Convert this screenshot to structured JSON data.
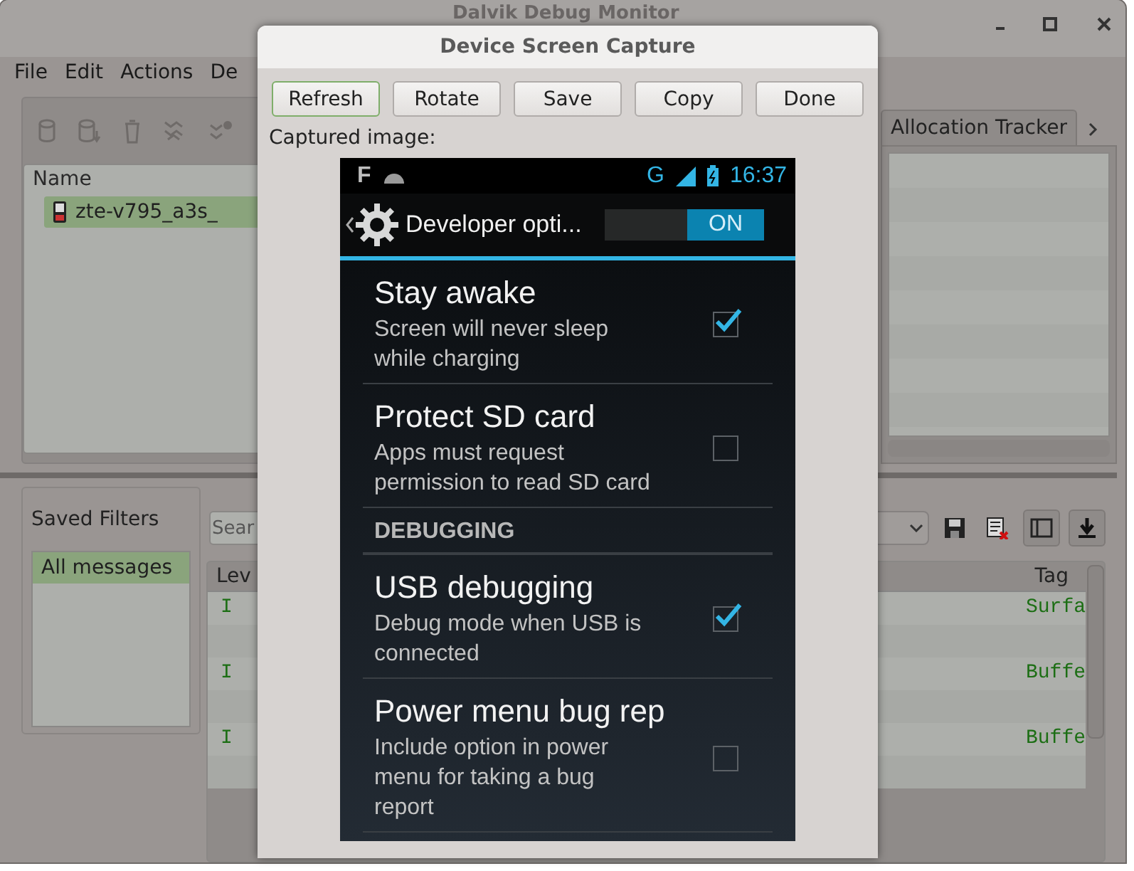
{
  "main_window": {
    "title": "Dalvik Debug Monitor",
    "menu": [
      "File",
      "Edit",
      "Actions",
      "De"
    ],
    "devices": {
      "column": "Name",
      "rows": [
        {
          "name": "zte-v795_a3s_",
          "selected": true
        }
      ]
    },
    "tabs": [
      {
        "label": "Allocation Tracker",
        "selected": false
      }
    ],
    "saved_filters": {
      "title": "Saved Filters",
      "items": [
        {
          "label": "All messages",
          "selected": true
        }
      ]
    },
    "search": {
      "placeholder": "Sear"
    },
    "log": {
      "columns": [
        "Lev",
        "Tag"
      ],
      "rows": [
        {
          "level": "I",
          "tag": "Surfa"
        },
        {
          "level": "I",
          "tag": "Buffe"
        },
        {
          "level": "I",
          "tag": "Buffe"
        }
      ]
    }
  },
  "dialog": {
    "title": "Device Screen Capture",
    "buttons": [
      {
        "label": "Refresh",
        "focused": true
      },
      {
        "label": "Rotate",
        "focused": false
      },
      {
        "label": "Save",
        "focused": false
      },
      {
        "label": "Copy",
        "focused": false
      },
      {
        "label": "Done",
        "focused": false
      }
    ],
    "caption": "Captured image:",
    "phone": {
      "status": {
        "notification": "F",
        "network": "G",
        "time": "16:37"
      },
      "header": {
        "title": "Developer opti...",
        "switch_label": "ON",
        "on": true
      },
      "items": [
        {
          "kind": "setting",
          "title": "Stay awake",
          "summary": "Screen will never sleep while charging",
          "checked": true
        },
        {
          "kind": "setting",
          "title": "Protect SD card",
          "summary": "Apps must request permission to read SD card",
          "checked": false
        },
        {
          "kind": "section",
          "title": "DEBUGGING"
        },
        {
          "kind": "setting",
          "title": "USB debugging",
          "summary": "Debug mode when USB is connected",
          "checked": true
        },
        {
          "kind": "setting",
          "title": "Power menu bug rep",
          "summary": "Include option in power menu for taking a bug report",
          "checked": false
        }
      ]
    }
  }
}
